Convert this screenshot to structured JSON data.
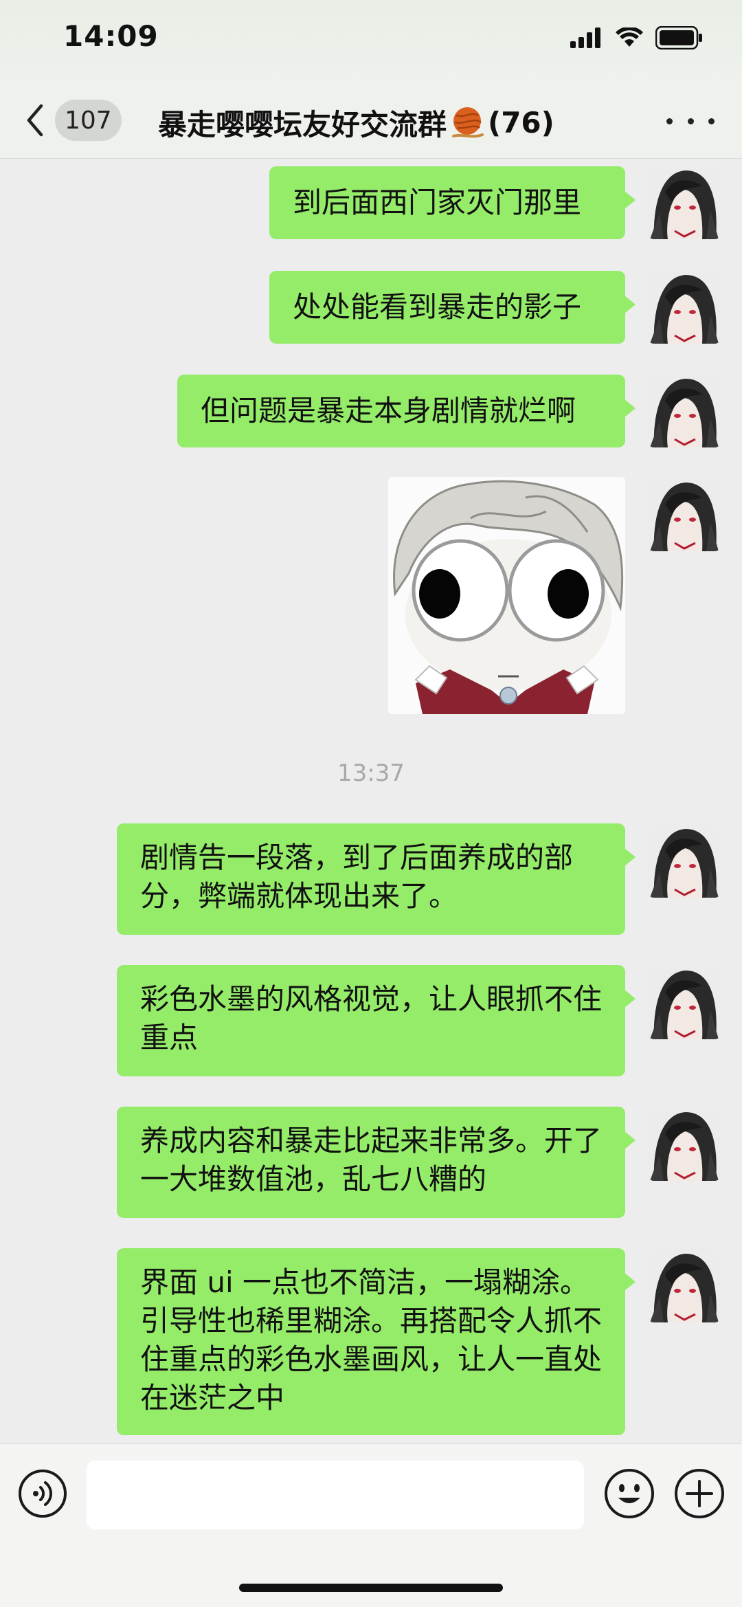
{
  "status_bar": {
    "time": "14:09",
    "icons": [
      "signal-icon",
      "wifi-icon",
      "battery-icon"
    ]
  },
  "nav": {
    "back_icon": "chevron-left-icon",
    "unread_count": "107",
    "title": "暴走嘤嘤坛友好交流群",
    "title_emoji": "yarn-ball-icon",
    "member_count": "(76)",
    "more_icon": "more-dots-icon"
  },
  "messages": [
    {
      "type": "text",
      "sender": "self",
      "text": "到后面西门家灭门那里"
    },
    {
      "type": "text",
      "sender": "self",
      "text": "处处能看到暴走的影子"
    },
    {
      "type": "text",
      "sender": "self",
      "text": "但问题是暴走本身剧情就烂啊"
    },
    {
      "type": "sticker",
      "sender": "self",
      "sticker": "wide-eyed-anime-face-sticker"
    },
    {
      "type": "text",
      "sender": "self",
      "text": "剧情告一段落，到了后面养成的部分，弊端就体现出来了。"
    },
    {
      "type": "text",
      "sender": "self",
      "text": "彩色水墨的风格视觉，让人眼抓不住重点"
    },
    {
      "type": "text",
      "sender": "self",
      "text": "养成内容和暴走比起来非常多。开了一大堆数值池，乱七八糟的"
    },
    {
      "type": "text",
      "sender": "self",
      "text": "界面 ui 一点也不简洁，一塌糊涂。引导性也稀里糊涂。再搭配令人抓不住重点的彩色水墨画风，让人一直处在迷茫之中"
    }
  ],
  "timestamp": "13:37",
  "input_bar": {
    "voice_icon": "voice-icon",
    "input_value": "",
    "emoji_icon": "emoji-icon",
    "plus_icon": "plus-icon"
  },
  "colors": {
    "bubble": "#95ec69",
    "background": "#ededed",
    "timestamp": "#a8a8a8"
  }
}
